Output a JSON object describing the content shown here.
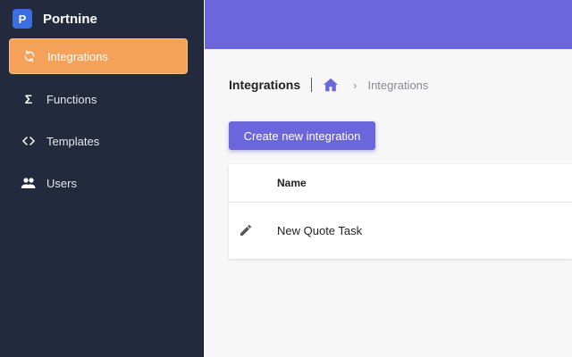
{
  "brand": {
    "logo_letter": "P",
    "name": "Portnine"
  },
  "sidebar": {
    "items": [
      {
        "label": "Integrations",
        "icon": "sync-icon",
        "active": true
      },
      {
        "label": "Functions",
        "icon": "sigma-icon",
        "active": false
      },
      {
        "label": "Templates",
        "icon": "code-icon",
        "active": false
      },
      {
        "label": "Users",
        "icon": "users-icon",
        "active": false
      }
    ]
  },
  "breadcrumb": {
    "title": "Integrations",
    "current": "Integrations"
  },
  "actions": {
    "create_label": "Create new integration"
  },
  "table": {
    "columns": [
      "Name"
    ],
    "rows": [
      {
        "name": "New Quote Task"
      }
    ]
  },
  "colors": {
    "accent": "#6c66dc",
    "active_nav": "#f4a25a",
    "sidebar_bg": "#232a3d",
    "logo": "#3b6fe0"
  }
}
